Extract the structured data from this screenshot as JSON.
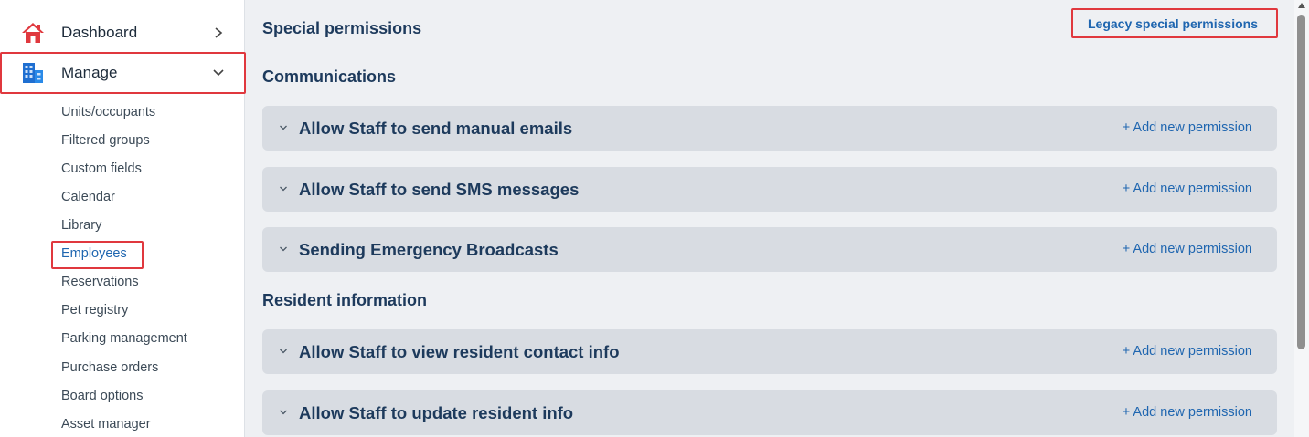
{
  "sidebar": {
    "dashboard": {
      "label": "Dashboard",
      "icon": "home-icon",
      "chevron": "chevron-right-icon"
    },
    "manage": {
      "label": "Manage",
      "icon": "building-icon",
      "chevron": "chevron-down-icon"
    },
    "sub_items": [
      {
        "label": "Units/occupants"
      },
      {
        "label": "Filtered groups"
      },
      {
        "label": "Custom fields"
      },
      {
        "label": "Calendar"
      },
      {
        "label": "Library"
      },
      {
        "label": "Employees"
      },
      {
        "label": "Reservations"
      },
      {
        "label": "Pet registry"
      },
      {
        "label": "Parking management"
      },
      {
        "label": "Purchase orders"
      },
      {
        "label": "Board options"
      },
      {
        "label": "Asset manager"
      }
    ],
    "active_item": "Employees"
  },
  "main": {
    "title": "Special permissions",
    "legacy_link": "Legacy special permissions",
    "sections": [
      {
        "title": "Communications",
        "permissions": [
          {
            "label": "Allow Staff to send manual emails",
            "action": "+ Add new permission"
          },
          {
            "label": "Allow Staff to send SMS messages",
            "action": "+ Add new permission"
          },
          {
            "label": "Sending Emergency Broadcasts",
            "action": "+ Add new permission"
          }
        ]
      },
      {
        "title": "Resident information",
        "permissions": [
          {
            "label": "Allow Staff to view resident contact info",
            "action": "+ Add new permission"
          },
          {
            "label": "Allow Staff to update resident info",
            "action": "+ Add new permission"
          }
        ]
      }
    ]
  },
  "colors": {
    "accent": "#1f66b0",
    "heading": "#1d3a5c",
    "row_bg": "#d8dce2",
    "page_bg": "#eef0f3",
    "highlight": "#e0383e"
  }
}
